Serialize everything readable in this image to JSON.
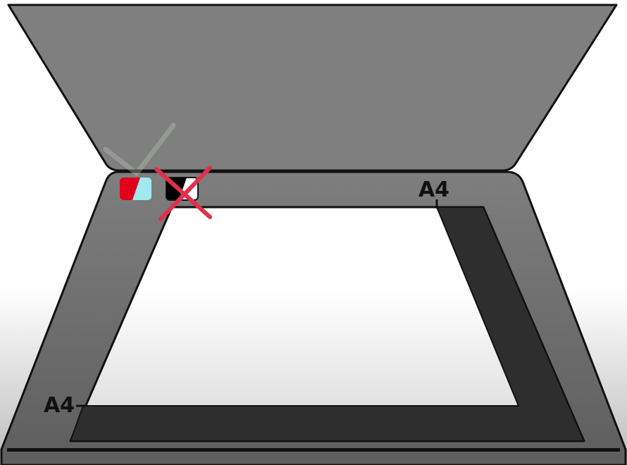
{
  "labels": {
    "a4_top": "A4",
    "a4_bottom": "A4"
  },
  "icons": {
    "color_mode": "color-mode-icon",
    "grayscale_mode": "grayscale-mode-icon",
    "checkmark": "checkmark-icon",
    "cross": "cross-icon"
  },
  "colors": {
    "lid": "#7f7f7f",
    "body": "#7a7a7a",
    "glass_top": "#ffffff",
    "glass_bottom": "#d8d8d8",
    "a4_region": "#2e2e2e",
    "outline": "#111111",
    "cross": "#e0304a",
    "checkmark": "#b8cdb8",
    "color_icon_red": "#e0001b",
    "color_icon_cyan": "#9fe9ef"
  },
  "selection": {
    "color_mode_selected": true,
    "grayscale_mode_selected": false
  }
}
